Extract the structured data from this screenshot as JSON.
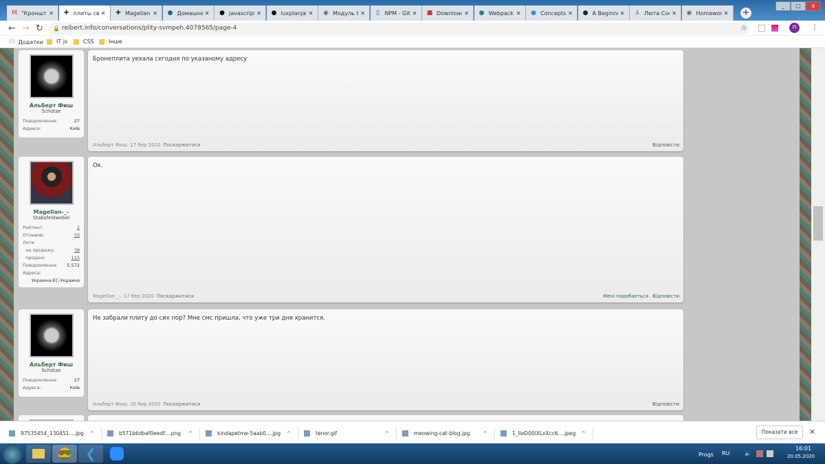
{
  "tabs": [
    {
      "label": "\"Кронште",
      "icon": "gmail-icon",
      "color": "#d93025",
      "glyph": "M"
    },
    {
      "label": "плиты свм",
      "icon": "reibert-icon",
      "color": "#333",
      "glyph": "✚",
      "active": true
    },
    {
      "label": "Magellan-",
      "icon": "reibert-icon",
      "color": "#333",
      "glyph": "✚"
    },
    {
      "label": "Домашнє",
      "icon": "site-icon",
      "color": "#1e6d7a",
      "glyph": "●"
    },
    {
      "label": "javascript",
      "icon": "github-icon",
      "color": "#111",
      "glyph": "●"
    },
    {
      "label": "luxplanjay",
      "icon": "github-icon",
      "color": "#111",
      "glyph": "●"
    },
    {
      "label": "Модуль 6",
      "icon": "globe-icon",
      "color": "#666",
      "glyph": "◉"
    },
    {
      "label": "NPM - Git",
      "icon": "book-icon",
      "color": "#555",
      "glyph": "▯"
    },
    {
      "label": "Download",
      "icon": "npm-icon",
      "color": "#cb3837",
      "glyph": "■"
    },
    {
      "label": "Webpack",
      "icon": "webpack-icon",
      "color": "#2b7a8a",
      "glyph": "●"
    },
    {
      "label": "Concepts",
      "icon": "webpack-icon",
      "color": "#3a8fd6",
      "glyph": "●"
    },
    {
      "label": "A Beginne",
      "icon": "site-icon",
      "color": "#222",
      "glyph": "●"
    },
    {
      "label": "Люта Coo",
      "icon": "site-icon",
      "color": "#555",
      "glyph": "⅄"
    },
    {
      "label": "Homework",
      "icon": "globe-icon",
      "color": "#666",
      "glyph": "◉"
    }
  ],
  "address": {
    "url": "reibert.info/conversations/plity-svmpeh.4078565/page-4"
  },
  "profile_initial": "п",
  "bookmarks": [
    {
      "label": "Додатки",
      "icon": "apps-icon"
    },
    {
      "label": "IT js",
      "icon": "folder-icon"
    },
    {
      "label": "CSS",
      "icon": "folder-icon"
    },
    {
      "label": "Інше",
      "icon": "folder-icon"
    }
  ],
  "posts": [
    {
      "user": "Альберт Фиш",
      "title": "Schütze",
      "stats": [
        {
          "k": "Повідомлення:",
          "v": "27"
        },
        {
          "k": "Адреса:",
          "v": "Київ"
        }
      ],
      "text": "Бронеплита уехала сегодня по указаному адресу",
      "meta": "Альберт Фиш, 17 бер 2020",
      "report": "Поскаржитися",
      "actions": [
        "Відповісти"
      ]
    },
    {
      "user": "Magellan-_-",
      "title": "Stabsfeldwebel",
      "stats": [
        {
          "k": "Рейтинг:",
          "v": "2",
          "link": true
        },
        {
          "k": "Отзывов:",
          "v": "33",
          "link": true
        },
        {
          "k": "Лоти",
          "v": ""
        },
        {
          "k": "  на продажу:",
          "v": "38",
          "link": true
        },
        {
          "k": "  продані:",
          "v": "115",
          "link": true
        },
        {
          "k": "Повідомлення:",
          "v": "5.572"
        },
        {
          "k": "Адреса:",
          "v": ""
        }
      ],
      "address_value": "Украина-ЕС-Украина",
      "text": "Ок.",
      "meta": "Magellan-_-, 17 бер 2020",
      "report": "Поскаржитися",
      "actions": [
        "Мені подобається",
        "Відповісти"
      ]
    },
    {
      "user": "Альберт Фиш",
      "title": "Schütze",
      "stats": [
        {
          "k": "Повідомлення:",
          "v": "27"
        },
        {
          "k": "Адреса:",
          "v": "Київ"
        }
      ],
      "text": "Не забрали плиту до сих пор? Мне смс пришла, что уже три дня хранится.",
      "meta": "Альберт Фиш, 20 бер 2020",
      "report": "Поскаржитися",
      "actions": [
        "Відповісти"
      ]
    }
  ],
  "downloads": {
    "items": [
      "97535454_130451....jpg",
      "b571b6dbaf0eedf....png",
      "kindapetme-5aab0....jpg",
      "tenor.gif",
      "meowing-cat-blog.jpg",
      "1_lleD00iXLxXcc6....jpeg"
    ],
    "show_all": "Показати все"
  },
  "taskbar": {
    "progs": "Progs",
    "lang": "RU",
    "time": "16:01",
    "date": "20.05.2020"
  }
}
